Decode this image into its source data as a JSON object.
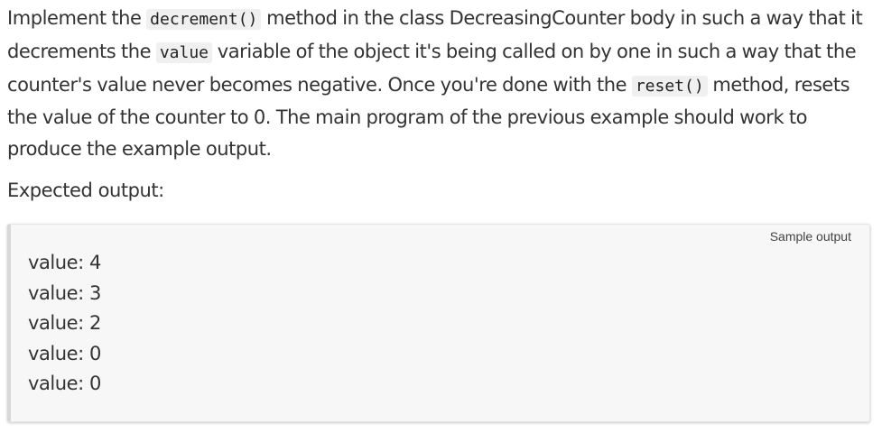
{
  "instructions": {
    "text_1": "Implement the ",
    "code_1": "decrement()",
    "text_2": " method in the class DecreasingCounter body in such a way that it decrements the ",
    "code_2": "value",
    "text_3": " variable of the object it's being called on by one in such a way that the counter's value never becomes negative. Once you're done with the ",
    "code_3": "reset()",
    "text_4": " method, resets the value of the counter to 0. The main program of the previous example should work to produce the example output."
  },
  "expected_label": "Expected output:",
  "sample_output": {
    "label": "Sample output",
    "lines": [
      "value: 4",
      "value: 3",
      "value: 2",
      "value: 0",
      "value: 0"
    ]
  }
}
